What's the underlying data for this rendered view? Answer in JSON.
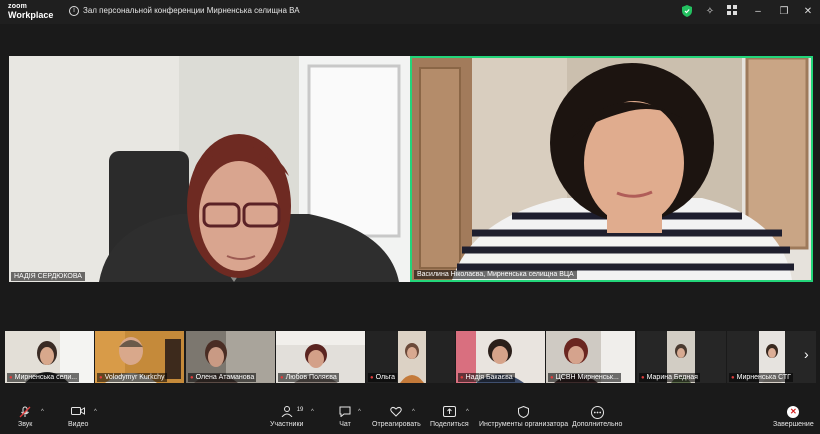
{
  "app": {
    "logo_line1": "zoom",
    "logo_line2": "Workplace"
  },
  "meeting": {
    "title": "Зал персональной конференции Мирненська селищна ВА"
  },
  "window_controls": [
    "shield-icon",
    "magic-icon",
    "grid-icon",
    "minimize",
    "restore",
    "close"
  ],
  "speakers": [
    {
      "name": "НАДІЯ СЕРДЮКОВА"
    },
    {
      "name": "Василина Ніколаєва, Мирненська селищна ВЦА",
      "active": true,
      "accent": "#23d57a"
    }
  ],
  "thumbnails": [
    {
      "name": "Мирненська сели..."
    },
    {
      "name": "Volodymyr Kurkchy"
    },
    {
      "name": "Олена Атаманова"
    },
    {
      "name": "Любов Поляєва"
    },
    {
      "name": "Ольга"
    },
    {
      "name": "Надія Бакаєва"
    },
    {
      "name": "ЦСВН Мирненськ..."
    },
    {
      "name": "Марина Бедная"
    },
    {
      "name": "Мирненська СТГ"
    }
  ],
  "toolbar": {
    "audio": "Звук",
    "video": "Видео",
    "participants": "Участники",
    "participants_count": "19",
    "chat": "Чат",
    "react": "Отреагировать",
    "share": "Поделиться",
    "host_tools": "Инструменты организатора",
    "more": "Дополнительно",
    "end": "Завершение"
  }
}
